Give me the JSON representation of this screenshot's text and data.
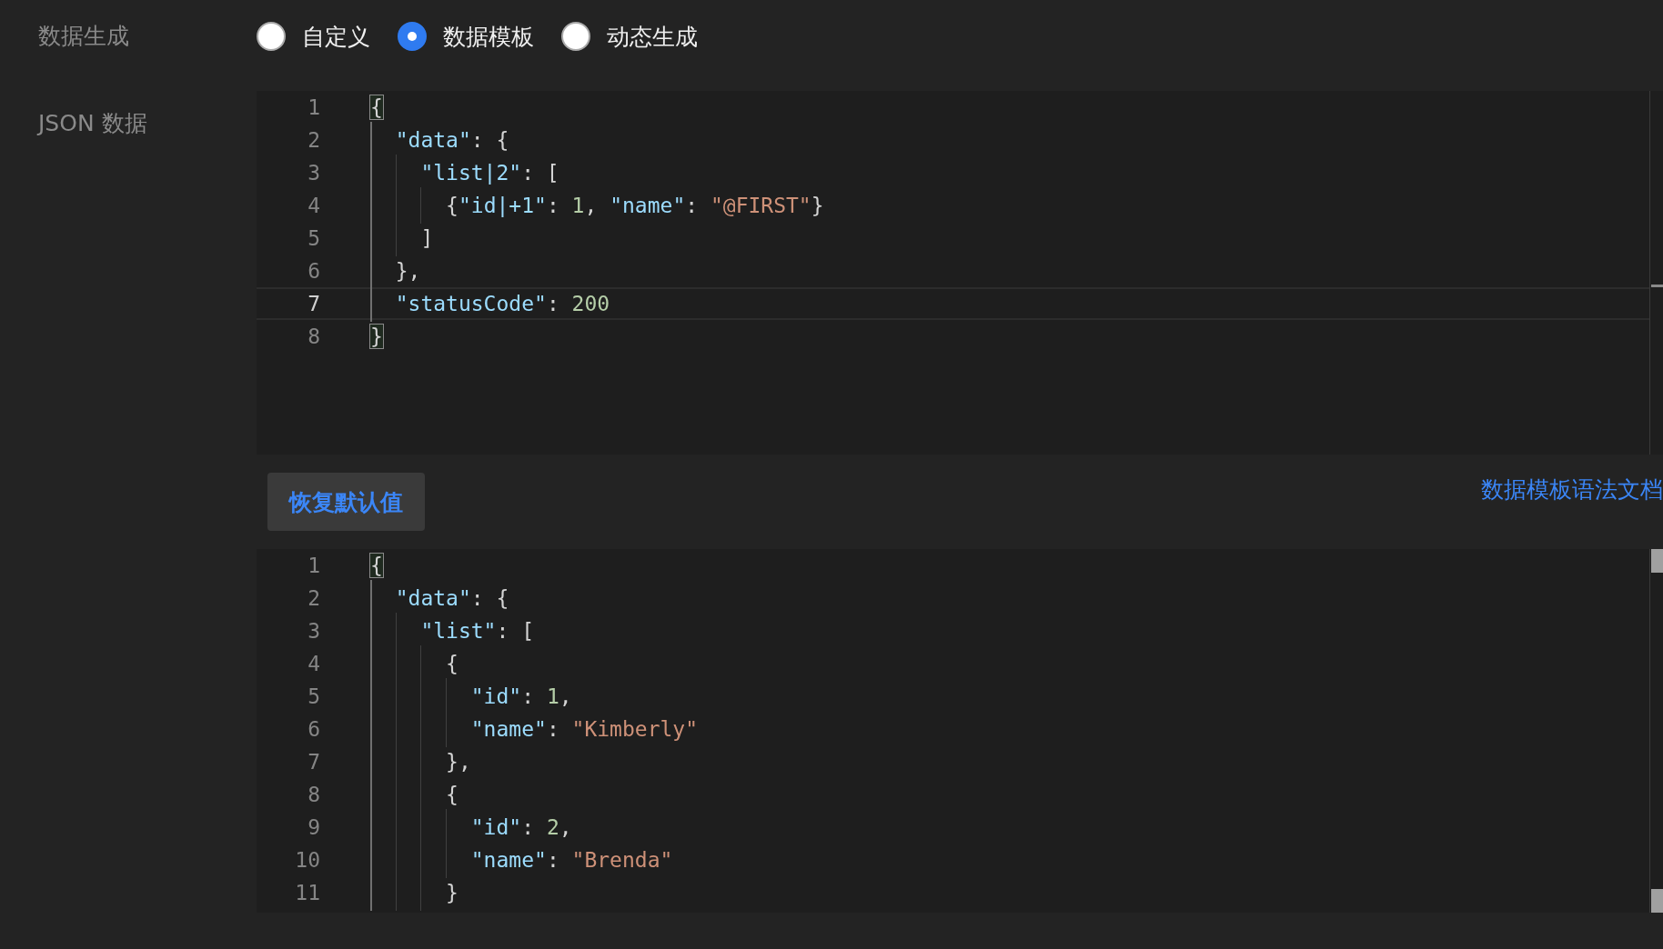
{
  "generation": {
    "label": "数据生成",
    "options": [
      {
        "label": "自定义",
        "selected": false
      },
      {
        "label": "数据模板",
        "selected": true
      },
      {
        "label": "动态生成",
        "selected": false
      }
    ]
  },
  "json_data": {
    "label": "JSON 数据",
    "template_editor": {
      "lines": [
        {
          "number": "1",
          "current": false,
          "tokens": [
            {
              "kind": "bracket",
              "text": "{"
            }
          ]
        },
        {
          "number": "2",
          "current": false,
          "tokens": [
            {
              "kind": "key",
              "text": "  \"data\""
            },
            {
              "kind": "punct",
              "text": ": {"
            }
          ]
        },
        {
          "number": "3",
          "current": false,
          "tokens": [
            {
              "kind": "key",
              "text": "    \"list|2\""
            },
            {
              "kind": "punct",
              "text": ": ["
            }
          ]
        },
        {
          "number": "4",
          "current": false,
          "tokens": [
            {
              "kind": "punct",
              "text": "      {"
            },
            {
              "kind": "key",
              "text": "\"id|+1\""
            },
            {
              "kind": "punct",
              "text": ": "
            },
            {
              "kind": "number",
              "text": "1"
            },
            {
              "kind": "punct",
              "text": ", "
            },
            {
              "kind": "key",
              "text": "\"name\""
            },
            {
              "kind": "punct",
              "text": ": "
            },
            {
              "kind": "string",
              "text": "\"@FIRST\""
            },
            {
              "kind": "punct",
              "text": "}"
            }
          ]
        },
        {
          "number": "5",
          "current": false,
          "tokens": [
            {
              "kind": "punct",
              "text": "    ]"
            }
          ]
        },
        {
          "number": "6",
          "current": false,
          "tokens": [
            {
              "kind": "punct",
              "text": "  },"
            }
          ]
        },
        {
          "number": "7",
          "current": true,
          "tokens": [
            {
              "kind": "key",
              "text": "  \"statusCode\""
            },
            {
              "kind": "punct",
              "text": ": "
            },
            {
              "kind": "number",
              "text": "200"
            }
          ]
        },
        {
          "number": "8",
          "current": false,
          "tokens": [
            {
              "kind": "bracket",
              "text": "}"
            }
          ]
        }
      ]
    },
    "reset_button": "恢复默认值",
    "docs_link": "数据模板语法文档",
    "preview_editor": {
      "lines": [
        {
          "number": "1",
          "current": false,
          "tokens": [
            {
              "kind": "bracket",
              "text": "{"
            }
          ]
        },
        {
          "number": "2",
          "current": false,
          "tokens": [
            {
              "kind": "key",
              "text": "  \"data\""
            },
            {
              "kind": "punct",
              "text": ": {"
            }
          ]
        },
        {
          "number": "3",
          "current": false,
          "tokens": [
            {
              "kind": "key",
              "text": "    \"list\""
            },
            {
              "kind": "punct",
              "text": ": ["
            }
          ]
        },
        {
          "number": "4",
          "current": false,
          "tokens": [
            {
              "kind": "punct",
              "text": "      {"
            }
          ]
        },
        {
          "number": "5",
          "current": false,
          "tokens": [
            {
              "kind": "key",
              "text": "        \"id\""
            },
            {
              "kind": "punct",
              "text": ": "
            },
            {
              "kind": "number",
              "text": "1"
            },
            {
              "kind": "punct",
              "text": ","
            }
          ]
        },
        {
          "number": "6",
          "current": false,
          "tokens": [
            {
              "kind": "key",
              "text": "        \"name\""
            },
            {
              "kind": "punct",
              "text": ": "
            },
            {
              "kind": "string",
              "text": "\"Kimberly\""
            }
          ]
        },
        {
          "number": "7",
          "current": false,
          "tokens": [
            {
              "kind": "punct",
              "text": "      },"
            }
          ]
        },
        {
          "number": "8",
          "current": false,
          "tokens": [
            {
              "kind": "punct",
              "text": "      {"
            }
          ]
        },
        {
          "number": "9",
          "current": false,
          "tokens": [
            {
              "kind": "key",
              "text": "        \"id\""
            },
            {
              "kind": "punct",
              "text": ": "
            },
            {
              "kind": "number",
              "text": "2"
            },
            {
              "kind": "punct",
              "text": ","
            }
          ]
        },
        {
          "number": "10",
          "current": false,
          "tokens": [
            {
              "kind": "key",
              "text": "        \"name\""
            },
            {
              "kind": "punct",
              "text": ": "
            },
            {
              "kind": "string",
              "text": "\"Brenda\""
            }
          ]
        },
        {
          "number": "11",
          "current": false,
          "tokens": [
            {
              "kind": "punct",
              "text": "      }"
            }
          ]
        }
      ]
    }
  }
}
